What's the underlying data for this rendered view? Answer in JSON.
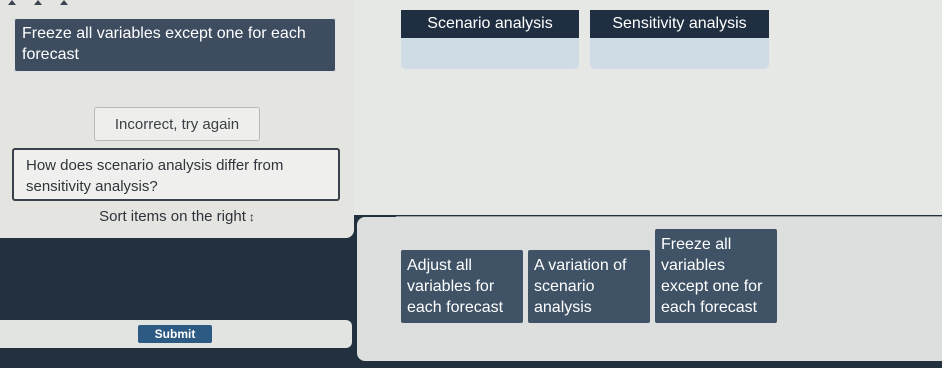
{
  "left_panel": {
    "answer_card": "Freeze all variables except one for each forecast",
    "feedback": "Incorrect, try again",
    "question": "How does scenario analysis differ from sensitivity analysis?",
    "instruction": "Sort items on the right",
    "sort_icon": "up-down-arrows-icon"
  },
  "categories": [
    {
      "label": "Scenario analysis"
    },
    {
      "label": "Sensitivity analysis"
    }
  ],
  "items": [
    {
      "label": "Adjust all variables for each forecast"
    },
    {
      "label": "A variation of scenario analysis"
    },
    {
      "label": "Freeze all variables except one for each forecast"
    }
  ],
  "submit": {
    "label": "Submit"
  },
  "colors": {
    "card": "#3f5266",
    "header": "#1f2e40",
    "drop_zone": "#cfdbe5",
    "submit": "#2d5a82"
  }
}
